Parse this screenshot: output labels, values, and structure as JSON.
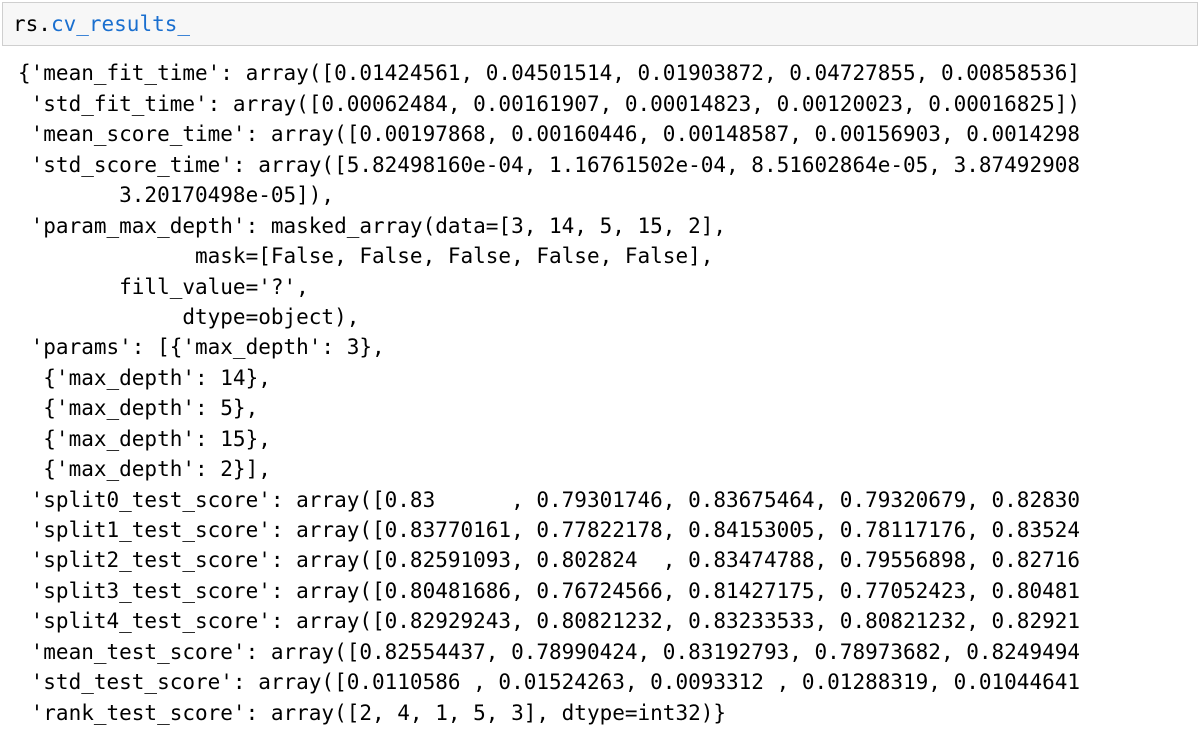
{
  "code": {
    "prefix": "rs.",
    "attr": "cv_results_"
  },
  "output_lines": [
    "{'mean_fit_time': array([0.01424561, 0.04501514, 0.01903872, 0.04727855, 0.00858536]",
    " 'std_fit_time': array([0.00062484, 0.00161907, 0.00014823, 0.00120023, 0.00016825])",
    " 'mean_score_time': array([0.00197868, 0.00160446, 0.00148587, 0.00156903, 0.0014298",
    " 'std_score_time': array([5.82498160e-04, 1.16761502e-04, 8.51602864e-05, 3.87492908",
    "        3.20170498e-05]),",
    " 'param_max_depth': masked_array(data=[3, 14, 5, 15, 2],",
    "              mask=[False, False, False, False, False],",
    "        fill_value='?',",
    "             dtype=object),",
    " 'params': [{'max_depth': 3},",
    "  {'max_depth': 14},",
    "  {'max_depth': 5},",
    "  {'max_depth': 15},",
    "  {'max_depth': 2}],",
    " 'split0_test_score': array([0.83      , 0.79301746, 0.83675464, 0.79320679, 0.82830",
    " 'split1_test_score': array([0.83770161, 0.77822178, 0.84153005, 0.78117176, 0.83524",
    " 'split2_test_score': array([0.82591093, 0.802824  , 0.83474788, 0.79556898, 0.82716",
    " 'split3_test_score': array([0.80481686, 0.76724566, 0.81427175, 0.77052423, 0.80481",
    " 'split4_test_score': array([0.82929243, 0.80821232, 0.83233533, 0.80821232, 0.82921",
    " 'mean_test_score': array([0.82554437, 0.78990424, 0.83192793, 0.78973682, 0.8249494",
    " 'std_test_score': array([0.0110586 , 0.01524263, 0.0093312 , 0.01288319, 0.01044641",
    " 'rank_test_score': array([2, 4, 1, 5, 3], dtype=int32)}"
  ],
  "chart_data": {
    "type": "table",
    "title": "sklearn cv_results_ dictionary",
    "keys": [
      "mean_fit_time",
      "std_fit_time",
      "mean_score_time",
      "std_score_time",
      "param_max_depth",
      "params",
      "split0_test_score",
      "split1_test_score",
      "split2_test_score",
      "split3_test_score",
      "split4_test_score",
      "mean_test_score",
      "std_test_score",
      "rank_test_score"
    ],
    "mean_fit_time": [
      0.01424561,
      0.04501514,
      0.01903872,
      0.04727855,
      0.00858536
    ],
    "std_fit_time": [
      0.00062484,
      0.00161907,
      0.00014823,
      0.00120023,
      0.00016825
    ],
    "mean_score_time_partial": [
      0.00197868,
      0.00160446,
      0.00148587,
      0.00156903,
      0.0014298
    ],
    "std_score_time_partial": [
      0.00058249816,
      0.000116761502,
      8.51602864e-05,
      3.87492908,
      3.20170498e-05
    ],
    "param_max_depth": [
      3,
      14,
      5,
      15,
      2
    ],
    "params": [
      {
        "max_depth": 3
      },
      {
        "max_depth": 14
      },
      {
        "max_depth": 5
      },
      {
        "max_depth": 15
      },
      {
        "max_depth": 2
      }
    ],
    "split0_test_score_partial": [
      0.83,
      0.79301746,
      0.83675464,
      0.79320679,
      0.8283
    ],
    "split1_test_score_partial": [
      0.83770161,
      0.77822178,
      0.84153005,
      0.78117176,
      0.83524
    ],
    "split2_test_score_partial": [
      0.82591093,
      0.802824,
      0.83474788,
      0.79556898,
      0.82716
    ],
    "split3_test_score_partial": [
      0.80481686,
      0.76724566,
      0.81427175,
      0.77052423,
      0.80481
    ],
    "split4_test_score_partial": [
      0.82929243,
      0.80821232,
      0.83233533,
      0.80821232,
      0.82921
    ],
    "mean_test_score_partial": [
      0.82554437,
      0.78990424,
      0.83192793,
      0.78973682,
      0.8249494
    ],
    "std_test_score_partial": [
      0.0110586,
      0.01524263,
      0.0093312,
      0.01288319,
      0.01044641
    ],
    "rank_test_score": [
      2,
      4,
      1,
      5,
      3
    ]
  }
}
